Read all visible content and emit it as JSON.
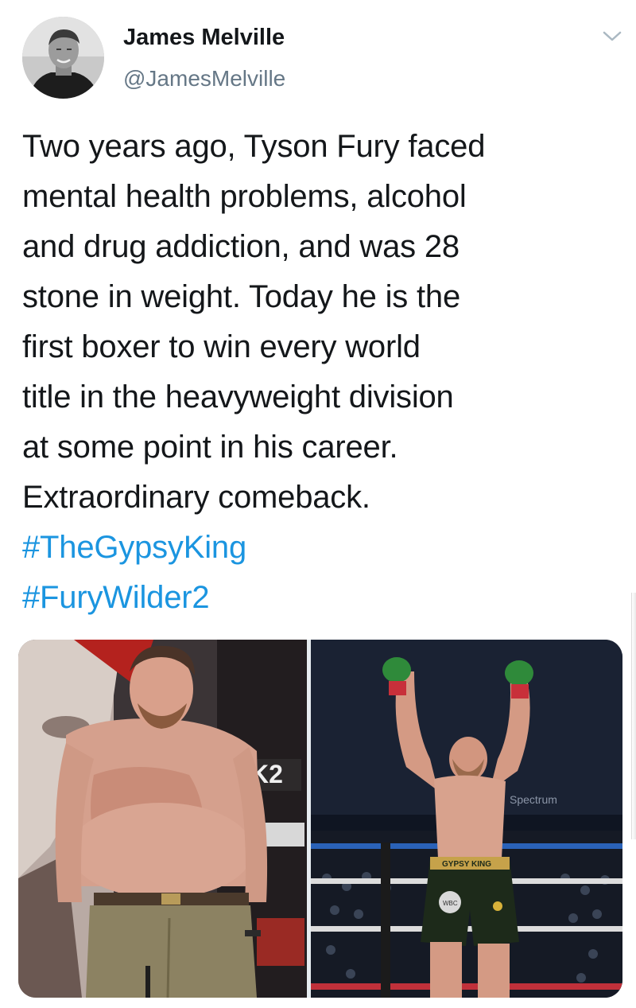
{
  "author": {
    "display_name": "James Melville",
    "handle": "@JamesMelville"
  },
  "tweet": {
    "lines": [
      "Two years ago, Tyson Fury faced",
      "mental health problems, alcohol",
      "and drug addiction, and was 28",
      "stone in weight. Today he is the",
      "first boxer to win every world",
      "title in the heavyweight division",
      "at some point in his career.",
      "Extraordinary comeback."
    ],
    "hashtags": [
      "#TheGypsyKing",
      "#FuryWilder2"
    ]
  },
  "media": {
    "left_sponsor_text": "K2",
    "right_trunks_text": "GYPSY KING",
    "right_banner_text": "Spectrum",
    "right_belt_text": "WBC"
  },
  "colors": {
    "hashtag": "#1b95e0",
    "handle": "#657786",
    "text": "#14171a"
  },
  "icons": {
    "menu": "chevron-down-icon"
  }
}
